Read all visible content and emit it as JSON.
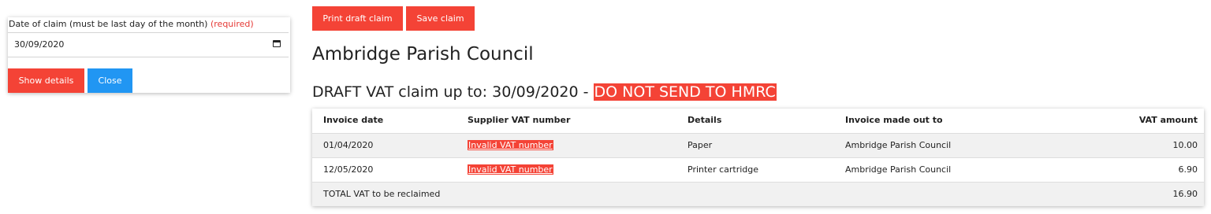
{
  "claim_form": {
    "date_label": "Date of claim (must be last day of the month)",
    "required_text": "(required)",
    "date_value": "30/09/2020",
    "show_details_label": "Show details",
    "close_label": "Close"
  },
  "toolbar": {
    "print_label": "Print draft claim",
    "save_label": "Save claim"
  },
  "page": {
    "council_name": "Ambridge Parish Council",
    "claim_heading": "DRAFT VAT claim up to: 30/09/2020 - ",
    "warning": "DO NOT SEND TO HMRC"
  },
  "table": {
    "headers": [
      "Invoice date",
      "Supplier VAT number",
      "Details",
      "Invoice made out to",
      "VAT amount"
    ],
    "rows": [
      {
        "date": "01/04/2020",
        "vat_number": "Invalid VAT number",
        "details": "Paper",
        "made_out_to": "Ambridge Parish Council",
        "amount": "10.00"
      },
      {
        "date": "12/05/2020",
        "vat_number": "Invalid VAT number",
        "details": "Printer cartridge",
        "made_out_to": "Ambridge Parish Council",
        "amount": "6.90"
      }
    ],
    "total_label": "TOTAL VAT to be reclaimed",
    "total_amount": "16.90"
  },
  "colors": {
    "accent_red": "#f44336",
    "accent_blue": "#2196f3"
  },
  "icons": {
    "date_picker": "calendar-icon"
  }
}
